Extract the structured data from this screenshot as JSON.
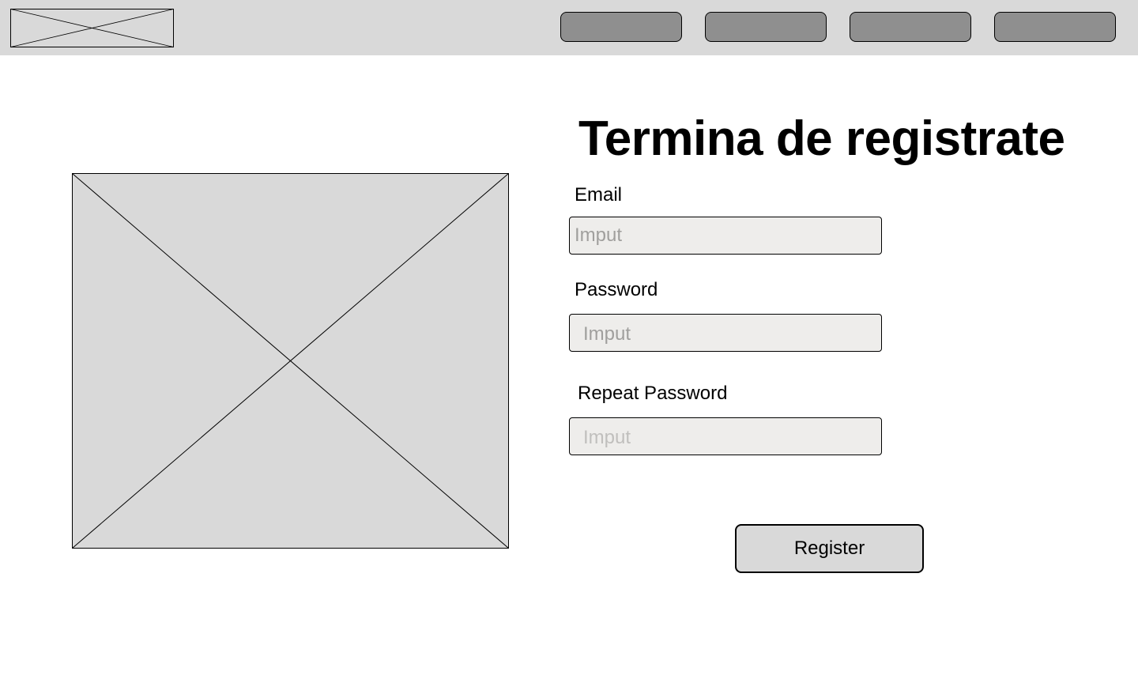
{
  "header": {
    "logo_icon": "image-placeholder-icon",
    "nav_buttons": [
      "",
      "",
      "",
      ""
    ]
  },
  "main": {
    "image_icon": "image-placeholder-icon",
    "title": "Termina de registrate",
    "form": {
      "email_label": "Email",
      "email_placeholder": "Imput",
      "password_label": "Password",
      "password_placeholder": "Imput",
      "repeat_password_label": "Repeat Password",
      "repeat_password_placeholder": "Imput",
      "register_label": "Register"
    }
  },
  "colors": {
    "header_bg": "#d9d9d9",
    "nav_button_bg": "#8f8f8f",
    "placeholder_bg": "#d9d9d9",
    "input_bg": "#eeedeb",
    "button_bg": "#d9d9d9",
    "text": "#000000"
  }
}
